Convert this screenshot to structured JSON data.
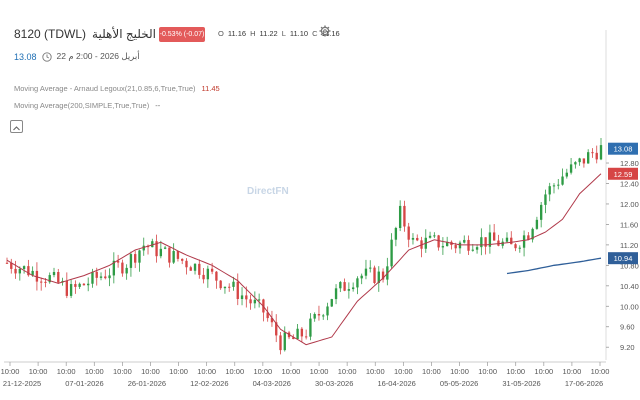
{
  "header": {
    "symbol": "8120  (TDWL)",
    "name": "إتحاد الخليج الأهلية",
    "change_badge": "-0.53% (-0.07)",
    "ohlc": [
      {
        "label": "O",
        "value": "11.16"
      },
      {
        "label": "H",
        "value": "11.22"
      },
      {
        "label": "L",
        "value": "11.10"
      },
      {
        "label": "C",
        "value": "11.16"
      }
    ],
    "last_price": "13.08",
    "timestamp": "22 أبريل 2026 - 2:00 م"
  },
  "indicators": [
    {
      "label": "Moving Average - Arnaud Legoux(21,0.85,6,True,True)",
      "value": "11.45"
    },
    {
      "label": "Moving Average(200,SIMPLE,True,True)",
      "value": "--"
    }
  ],
  "watermark": "DirectFN",
  "colors": {
    "up": "#2e9b45",
    "down": "#d64545",
    "alma_line": "#b0394a",
    "sma_line": "#2f5f99",
    "badge_red": "#e35a5a",
    "last_price_box": "#2f6fb0",
    "alma_box": "#d64545",
    "sma_box": "#2f5f99"
  },
  "chart_data": {
    "type": "candlestick",
    "y_ticks": [
      9.2,
      9.6,
      10.0,
      10.4,
      10.8,
      11.2,
      11.6,
      12.0,
      12.4,
      12.8
    ],
    "ylim": [
      8.95,
      13.25
    ],
    "price_labels": [
      {
        "label": "13.08",
        "value": 13.08,
        "color": "#2f6fb0"
      },
      {
        "label": "12.59",
        "value": 12.59,
        "color": "#d64545"
      },
      {
        "label": "10.94",
        "value": 10.94,
        "color": "#2f5f99"
      }
    ],
    "x_time_ticks": [
      "10:00",
      "10:00",
      "10:00",
      "10:00",
      "10:00",
      "10:00",
      "10:00",
      "10:00",
      "10:00",
      "10:00",
      "10:00",
      "10:00",
      "10:00",
      "10:00",
      "10:00",
      "10:00",
      "10:00",
      "10:00",
      "10:00",
      "10:00",
      "10:00",
      "10:00"
    ],
    "x_date_ticks": [
      "21-12-2025",
      "07-01-2026",
      "26-01-2026",
      "12-02-2026",
      "04-03-2026",
      "30-03-2026",
      "16-04-2026",
      "05-05-2026",
      "31-05-2026",
      "17-06-2026"
    ],
    "anchors": [
      [
        0,
        10.85
      ],
      [
        10,
        10.55
      ],
      [
        15,
        10.3
      ],
      [
        22,
        10.6
      ],
      [
        28,
        10.85
      ],
      [
        32,
        11.2
      ],
      [
        38,
        11.0
      ],
      [
        45,
        10.75
      ],
      [
        52,
        10.4
      ],
      [
        60,
        9.9
      ],
      [
        64,
        9.3
      ],
      [
        67,
        9.35
      ],
      [
        70,
        9.5
      ],
      [
        76,
        10.2
      ],
      [
        82,
        10.6
      ],
      [
        88,
        10.6
      ],
      [
        92,
        11.8
      ],
      [
        95,
        11.25
      ],
      [
        100,
        11.25
      ],
      [
        105,
        11.2
      ],
      [
        110,
        11.3
      ],
      [
        115,
        11.25
      ],
      [
        118,
        11.15
      ],
      [
        122,
        11.45
      ],
      [
        126,
        12.2
      ],
      [
        130,
        12.55
      ],
      [
        134,
        12.8
      ],
      [
        137,
        13.0
      ],
      [
        139,
        13.08
      ]
    ],
    "alma_anchors": [
      [
        0,
        10.9
      ],
      [
        6,
        10.6
      ],
      [
        12,
        10.45
      ],
      [
        18,
        10.6
      ],
      [
        24,
        10.8
      ],
      [
        30,
        11.1
      ],
      [
        36,
        11.25
      ],
      [
        42,
        11.0
      ],
      [
        48,
        10.8
      ],
      [
        54,
        10.5
      ],
      [
        60,
        10.0
      ],
      [
        64,
        9.55
      ],
      [
        70,
        9.25
      ],
      [
        76,
        9.4
      ],
      [
        82,
        10.1
      ],
      [
        88,
        10.55
      ],
      [
        94,
        11.1
      ],
      [
        100,
        11.3
      ],
      [
        106,
        11.2
      ],
      [
        112,
        11.2
      ],
      [
        118,
        11.25
      ],
      [
        122,
        11.3
      ],
      [
        126,
        11.45
      ],
      [
        130,
        11.7
      ],
      [
        134,
        12.2
      ],
      [
        139,
        12.59
      ]
    ],
    "sma_anchors": [
      [
        117,
        10.64
      ],
      [
        122,
        10.7
      ],
      [
        128,
        10.8
      ],
      [
        134,
        10.87
      ],
      [
        139,
        10.94
      ]
    ]
  }
}
